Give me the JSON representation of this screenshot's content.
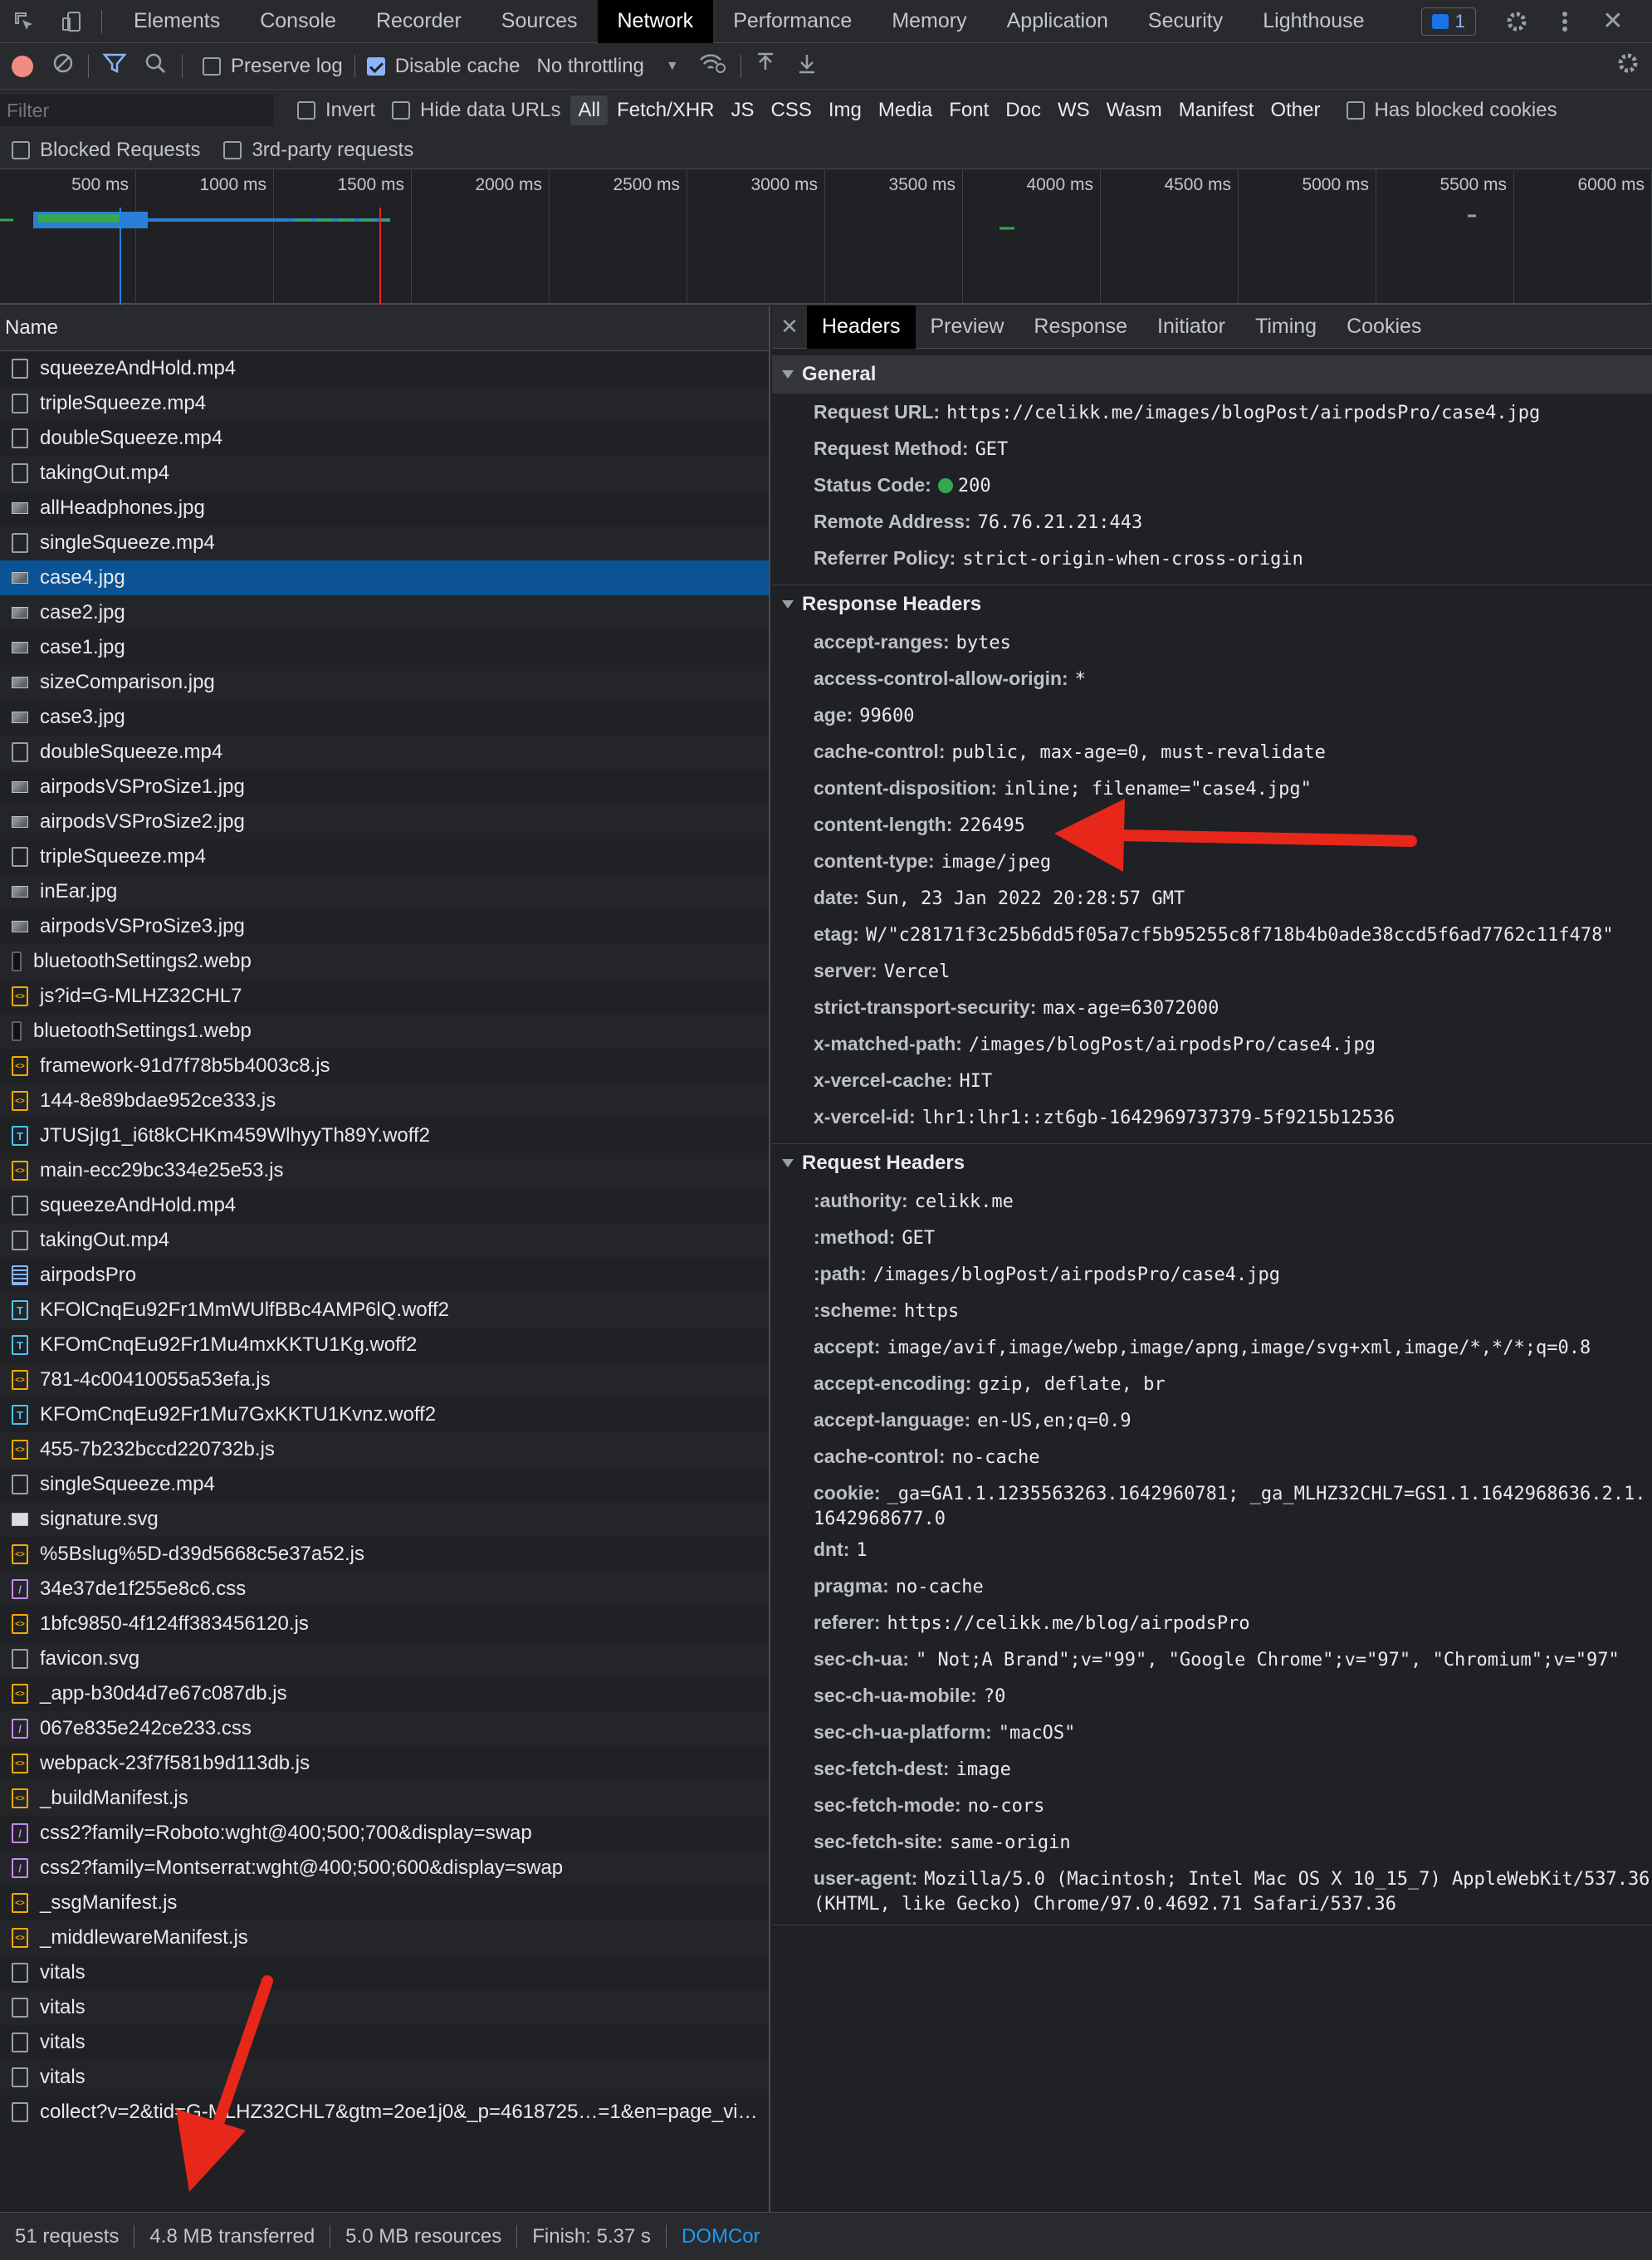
{
  "panel_tabs": [
    "Elements",
    "Console",
    "Recorder",
    "Sources",
    "Network",
    "Performance",
    "Memory",
    "Application",
    "Security",
    "Lighthouse"
  ],
  "active_panel_tab": "Network",
  "message_badge_count": "1",
  "toolbar": {
    "preserve_log_label": "Preserve log",
    "disable_cache_label": "Disable cache",
    "throttling_value": "No throttling"
  },
  "filter": {
    "placeholder": "Filter",
    "invert_label": "Invert",
    "hide_data_urls_label": "Hide data URLs",
    "types": [
      "All",
      "Fetch/XHR",
      "JS",
      "CSS",
      "Img",
      "Media",
      "Font",
      "Doc",
      "WS",
      "Wasm",
      "Manifest",
      "Other"
    ],
    "active_type": "All",
    "has_blocked_cookies_label": "Has blocked cookies",
    "blocked_requests_label": "Blocked Requests",
    "third_party_label": "3rd-party requests"
  },
  "overview_ticks": [
    "500 ms",
    "1000 ms",
    "1500 ms",
    "2000 ms",
    "2500 ms",
    "3000 ms",
    "3500 ms",
    "4000 ms",
    "4500 ms",
    "5000 ms",
    "5500 ms",
    "6000 ms"
  ],
  "list": {
    "column_name": "Name",
    "requests": [
      {
        "name": "squeezeAndHold.mp4",
        "type": "doc"
      },
      {
        "name": "tripleSqueeze.mp4",
        "type": "doc"
      },
      {
        "name": "doubleSqueeze.mp4",
        "type": "doc"
      },
      {
        "name": "takingOut.mp4",
        "type": "doc"
      },
      {
        "name": "allHeadphones.jpg",
        "type": "img"
      },
      {
        "name": "singleSqueeze.mp4",
        "type": "doc"
      },
      {
        "name": "case4.jpg",
        "type": "img",
        "selected": true
      },
      {
        "name": "case2.jpg",
        "type": "img"
      },
      {
        "name": "case1.jpg",
        "type": "img"
      },
      {
        "name": "sizeComparison.jpg",
        "type": "img"
      },
      {
        "name": "case3.jpg",
        "type": "img"
      },
      {
        "name": "doubleSqueeze.mp4",
        "type": "doc"
      },
      {
        "name": "airpodsVSProSize1.jpg",
        "type": "img"
      },
      {
        "name": "airpodsVSProSize2.jpg",
        "type": "img"
      },
      {
        "name": "tripleSqueeze.mp4",
        "type": "doc"
      },
      {
        "name": "inEar.jpg",
        "type": "img"
      },
      {
        "name": "airpodsVSProSize3.jpg",
        "type": "img"
      },
      {
        "name": "bluetoothSettings2.webp",
        "type": "webp"
      },
      {
        "name": "js?id=G-MLHZ32CHL7",
        "type": "script"
      },
      {
        "name": "bluetoothSettings1.webp",
        "type": "webp"
      },
      {
        "name": "framework-91d7f78b5b4003c8.js",
        "type": "script"
      },
      {
        "name": "144-8e89bdae952ce333.js",
        "type": "script"
      },
      {
        "name": "JTUSjIg1_i6t8kCHKm459WlhyyTh89Y.woff2",
        "type": "font"
      },
      {
        "name": "main-ecc29bc334e25e53.js",
        "type": "script"
      },
      {
        "name": "squeezeAndHold.mp4",
        "type": "doc"
      },
      {
        "name": "takingOut.mp4",
        "type": "doc"
      },
      {
        "name": "airpodsPro",
        "type": "page"
      },
      {
        "name": "KFOlCnqEu92Fr1MmWUlfBBc4AMP6lQ.woff2",
        "type": "font"
      },
      {
        "name": "KFOmCnqEu92Fr1Mu4mxKKTU1Kg.woff2",
        "type": "font"
      },
      {
        "name": "781-4c00410055a53efa.js",
        "type": "script"
      },
      {
        "name": "KFOmCnqEu92Fr1Mu7GxKKTU1Kvnz.woff2",
        "type": "font"
      },
      {
        "name": "455-7b232bccd220732b.js",
        "type": "script"
      },
      {
        "name": "singleSqueeze.mp4",
        "type": "doc"
      },
      {
        "name": "signature.svg",
        "type": "svg"
      },
      {
        "name": "%5Bslug%5D-d39d5668c5e37a52.js",
        "type": "script"
      },
      {
        "name": "34e37de1f255e8c6.css",
        "type": "css"
      },
      {
        "name": "1bfc9850-4f124ff383456120.js",
        "type": "script"
      },
      {
        "name": "favicon.svg",
        "type": "doc"
      },
      {
        "name": "_app-b30d4d7e67c087db.js",
        "type": "script"
      },
      {
        "name": "067e835e242ce233.css",
        "type": "css"
      },
      {
        "name": "webpack-23f7f581b9d113db.js",
        "type": "script"
      },
      {
        "name": "_buildManifest.js",
        "type": "script"
      },
      {
        "name": "css2?family=Roboto:wght@400;500;700&display=swap",
        "type": "css"
      },
      {
        "name": "css2?family=Montserrat:wght@400;500;600&display=swap",
        "type": "css"
      },
      {
        "name": "_ssgManifest.js",
        "type": "script"
      },
      {
        "name": "_middlewareManifest.js",
        "type": "script"
      },
      {
        "name": "vitals",
        "type": "doc"
      },
      {
        "name": "vitals",
        "type": "doc"
      },
      {
        "name": "vitals",
        "type": "doc"
      },
      {
        "name": "vitals",
        "type": "doc"
      },
      {
        "name": "collect?v=2&tid=G-MLHZ32CHL7&gtm=2oe1j0&_p=4618725…=1&en=page_vi…",
        "type": "doc"
      }
    ]
  },
  "status_bar": {
    "requests": "51 requests",
    "transferred": "4.8 MB transferred",
    "resources": "5.0 MB resources",
    "finish": "Finish: 5.37 s",
    "domcontent": "DOMCor"
  },
  "detail_tabs": [
    "Headers",
    "Preview",
    "Response",
    "Initiator",
    "Timing",
    "Cookies"
  ],
  "active_detail_tab": "Headers",
  "general": {
    "title": "General",
    "rows": [
      {
        "key": "Request URL:",
        "value": "https://celikk.me/images/blogPost/airpodsPro/case4.jpg"
      },
      {
        "key": "Request Method:",
        "value": "GET"
      },
      {
        "key": "Status Code:",
        "value": "200",
        "status_dot": true
      },
      {
        "key": "Remote Address:",
        "value": "76.76.21.21:443"
      },
      {
        "key": "Referrer Policy:",
        "value": "strict-origin-when-cross-origin"
      }
    ]
  },
  "response_headers": {
    "title": "Response Headers",
    "rows": [
      {
        "key": "accept-ranges:",
        "value": "bytes"
      },
      {
        "key": "access-control-allow-origin:",
        "value": "*"
      },
      {
        "key": "age:",
        "value": "99600"
      },
      {
        "key": "cache-control:",
        "value": "public, max-age=0, must-revalidate"
      },
      {
        "key": "content-disposition:",
        "value": "inline; filename=\"case4.jpg\""
      },
      {
        "key": "content-length:",
        "value": "226495"
      },
      {
        "key": "content-type:",
        "value": "image/jpeg"
      },
      {
        "key": "date:",
        "value": "Sun, 23 Jan 2022 20:28:57 GMT"
      },
      {
        "key": "etag:",
        "value": "W/\"c28171f3c25b6dd5f05a7cf5b95255c8f718b4b0ade38ccd5f6ad7762c11f478\""
      },
      {
        "key": "server:",
        "value": "Vercel"
      },
      {
        "key": "strict-transport-security:",
        "value": "max-age=63072000"
      },
      {
        "key": "x-matched-path:",
        "value": "/images/blogPost/airpodsPro/case4.jpg"
      },
      {
        "key": "x-vercel-cache:",
        "value": "HIT"
      },
      {
        "key": "x-vercel-id:",
        "value": "lhr1:lhr1::zt6gb-1642969737379-5f9215b12536"
      }
    ]
  },
  "request_headers": {
    "title": "Request Headers",
    "rows": [
      {
        "key": ":authority:",
        "value": "celikk.me"
      },
      {
        "key": ":method:",
        "value": "GET"
      },
      {
        "key": ":path:",
        "value": "/images/blogPost/airpodsPro/case4.jpg"
      },
      {
        "key": ":scheme:",
        "value": "https"
      },
      {
        "key": "accept:",
        "value": "image/avif,image/webp,image/apng,image/svg+xml,image/*,*/*;q=0.8"
      },
      {
        "key": "accept-encoding:",
        "value": "gzip, deflate, br"
      },
      {
        "key": "accept-language:",
        "value": "en-US,en;q=0.9"
      },
      {
        "key": "cache-control:",
        "value": "no-cache"
      },
      {
        "key": "cookie:",
        "value": "_ga=GA1.1.1235563263.1642960781; _ga_MLHZ32CHL7=GS1.1.1642968636.2.1.1642968677.0"
      },
      {
        "key": "dnt:",
        "value": "1"
      },
      {
        "key": "pragma:",
        "value": "no-cache"
      },
      {
        "key": "referer:",
        "value": "https://celikk.me/blog/airpodsPro"
      },
      {
        "key": "sec-ch-ua:",
        "value": "\" Not;A Brand\";v=\"99\", \"Google Chrome\";v=\"97\", \"Chromium\";v=\"97\""
      },
      {
        "key": "sec-ch-ua-mobile:",
        "value": "?0"
      },
      {
        "key": "sec-ch-ua-platform:",
        "value": "\"macOS\""
      },
      {
        "key": "sec-fetch-dest:",
        "value": "image"
      },
      {
        "key": "sec-fetch-mode:",
        "value": "no-cors"
      },
      {
        "key": "sec-fetch-site:",
        "value": "same-origin"
      },
      {
        "key": "user-agent:",
        "value": "Mozilla/5.0 (Macintosh; Intel Mac OS X 10_15_7) AppleWebKit/537.36 (KHTML, like Gecko) Chrome/97.0.4692.71 Safari/537.36"
      }
    ]
  },
  "colors": {
    "annotation_arrow": "#e8271b",
    "selected_row": "#0b5394",
    "status_ok": "#34a853"
  }
}
